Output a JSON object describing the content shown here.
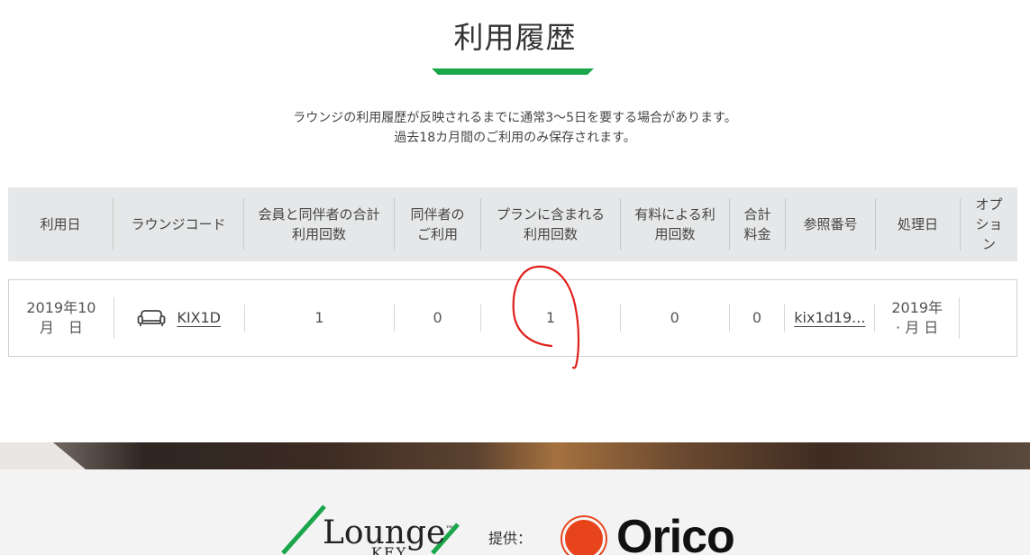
{
  "page": {
    "title": "利用履歴",
    "notice_line1": "ラウンジの利用履歴が反映されるまでに通常3～5日を要する場合があります。",
    "notice_line2": "過去18カ月間のご利用のみ保存されます。"
  },
  "colors": {
    "accent": "#1aa64a",
    "annotation": "#e0201c",
    "orico": "#e8441c"
  },
  "table": {
    "headers": [
      {
        "line1": "利用日",
        "line2": ""
      },
      {
        "line1": "ラウンジコード",
        "line2": ""
      },
      {
        "line1": "会員と同伴者の合計",
        "line2": "利用回数"
      },
      {
        "line1": "同伴者の",
        "line2": "ご利用"
      },
      {
        "line1": "プランに含まれる",
        "line2": "利用回数"
      },
      {
        "line1": "有料による利",
        "line2": "用回数"
      },
      {
        "line1": "合計",
        "line2": "料金"
      },
      {
        "line1": "参照番号",
        "line2": ""
      },
      {
        "line1": "処理日",
        "line2": ""
      },
      {
        "line1": "オプ",
        "line2": "ショ",
        "line3": "ン"
      }
    ],
    "row": {
      "date_line1": "2019年10",
      "date_line2": "月　日",
      "lounge_icon": "sofa-icon",
      "lounge_code": "KIX1D",
      "total_uses": "1",
      "companion_uses": "0",
      "plan_uses": "1",
      "paid_uses": "0",
      "total_fee": "0",
      "reference": "kix1d19...",
      "processed_line1": "2019年",
      "processed_line2": "· 月 日",
      "option": ""
    }
  },
  "footer": {
    "lounge_logo_text": "Lounge",
    "lounge_logo_tm": "™",
    "lounge_logo_sub": "KEY",
    "provided_by": "提供：",
    "orico_logo_text": "Orico"
  }
}
